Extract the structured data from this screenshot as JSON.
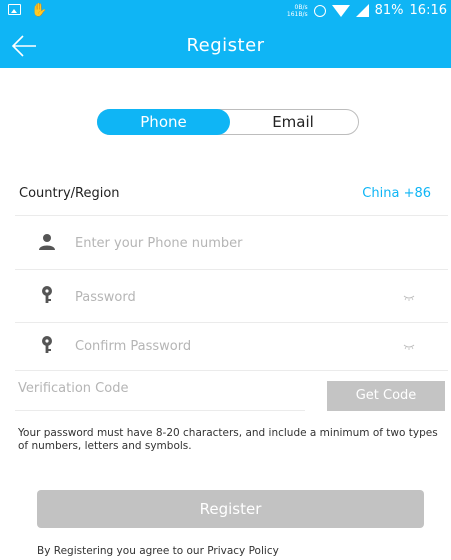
{
  "status_bar": {
    "net_speed_top": "0B/s",
    "net_speed_bottom": "161B/s",
    "battery": "81%",
    "time": "16:16"
  },
  "app_bar": {
    "title": "Register"
  },
  "tabs": [
    {
      "label": "Phone",
      "selected": true
    },
    {
      "label": "Email",
      "selected": false
    }
  ],
  "form": {
    "country_label": "Country/Region",
    "country_value": "China +86",
    "phone_placeholder": "Enter your Phone number",
    "password_placeholder": "Password",
    "confirm_password_placeholder": "Confirm Password",
    "code_placeholder": "Verification Code",
    "get_code_label": "Get Code",
    "password_hint": "Your password must have 8-20 characters, and include a minimum of two types of numbers, letters and symbols.",
    "register_label": "Register",
    "policy_text": "By Registering you agree to our Privacy Policy"
  },
  "colors": {
    "accent": "#0fb5f5",
    "disabled_button": "#c2c2c2",
    "placeholder": "#b5b5b5"
  }
}
